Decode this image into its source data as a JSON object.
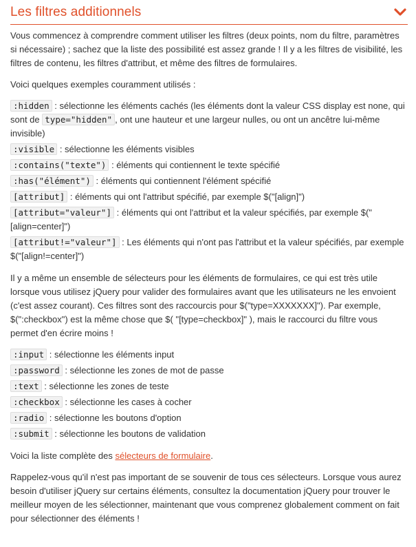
{
  "section": {
    "title": "Les filtres additionnels",
    "toggle_icon": "chevron-down-icon",
    "accent": "#e0502a"
  },
  "intro": {
    "p1": "Vous commencez à comprendre comment utiliser les filtres (deux points, nom du filtre, paramètres si nécessaire) ; sachez que la liste des possibilité est assez grande ! Il y a les filtres de visibilité, les filtres de contenu, les filtres d'attribut, et même des filtres de formulaires.",
    "p2": "Voici quelques exemples couramment utilisés :"
  },
  "filters": [
    {
      "code": ":hidden",
      "text_a": " : sélectionne les éléments cachés (les éléments dont la valeur CSS display est none, qui sont de ",
      "code2": "type=\"hidden\"",
      "text_b": ", ont une hauteur et une largeur nulles, ou ont un ancêtre lui-même invisible)"
    },
    {
      "code": ":visible",
      "text_a": " : sélectionne les éléments visibles"
    },
    {
      "code": ":contains(\"texte\")",
      "text_a": " : éléments qui contiennent le texte spécifié"
    },
    {
      "code": ":has(\"élément\")",
      "text_a": " : éléments qui contiennent l'élément spécifié"
    },
    {
      "code": "[attribut]",
      "text_a": " : éléments qui ont l'attribut spécifié, par exemple $(\"[align]\")"
    },
    {
      "code": "[attribut=\"valeur\"]",
      "text_a": " : éléments qui ont l'attribut et la valeur spécifiés, par exemple $(\"[align=center]\")"
    },
    {
      "code": "[attribut!=\"valeur\"]",
      "text_a": " : Les éléments qui n'ont pas l'attribut et la valeur spécifiés, par exemple $(\"[align!=center]\")"
    }
  ],
  "forms_intro": "Il y a même un ensemble de sélecteurs pour les éléments de formulaires, ce qui est très utile lorsque vous utilisez jQuery pour valider des formulaires avant que les utilisateurs ne les envoient (c'est assez courant). Ces filtres sont des raccourcis pour $(\"type=XXXXXXX]\"). Par exemple, $(\":checkbox\") est la même chose que $( \"[type=checkbox]\" ), mais le raccourci du filtre vous permet d'en écrire moins !",
  "form_filters": [
    {
      "code": ":input",
      "text": " : sélectionne les éléments input"
    },
    {
      "code": ":password",
      "text": " : sélectionne les zones de mot de passe"
    },
    {
      "code": ":text",
      "text": " : sélectionne les zones de teste"
    },
    {
      "code": ":checkbox",
      "text": " : sélectionne les cases à cocher"
    },
    {
      "code": ":radio",
      "text": " : sélectionne les boutons d'option"
    },
    {
      "code": ":submit",
      "text": " : sélectionne les boutons de validation"
    }
  ],
  "full_list": {
    "before": "Voici la liste complète des ",
    "link": "sélecteurs de formulaire",
    "after": "."
  },
  "closing": "Rappelez-vous qu'il n'est pas important de se souvenir de tous ces sélecteurs. Lorsque vous aurez besoin d'utiliser jQuery sur certains éléments, consultez la documentation jQuery pour trouver le meilleur moyen de les sélectionner, maintenant que vous comprenez globalement comment on fait pour sélectionner des éléments !"
}
